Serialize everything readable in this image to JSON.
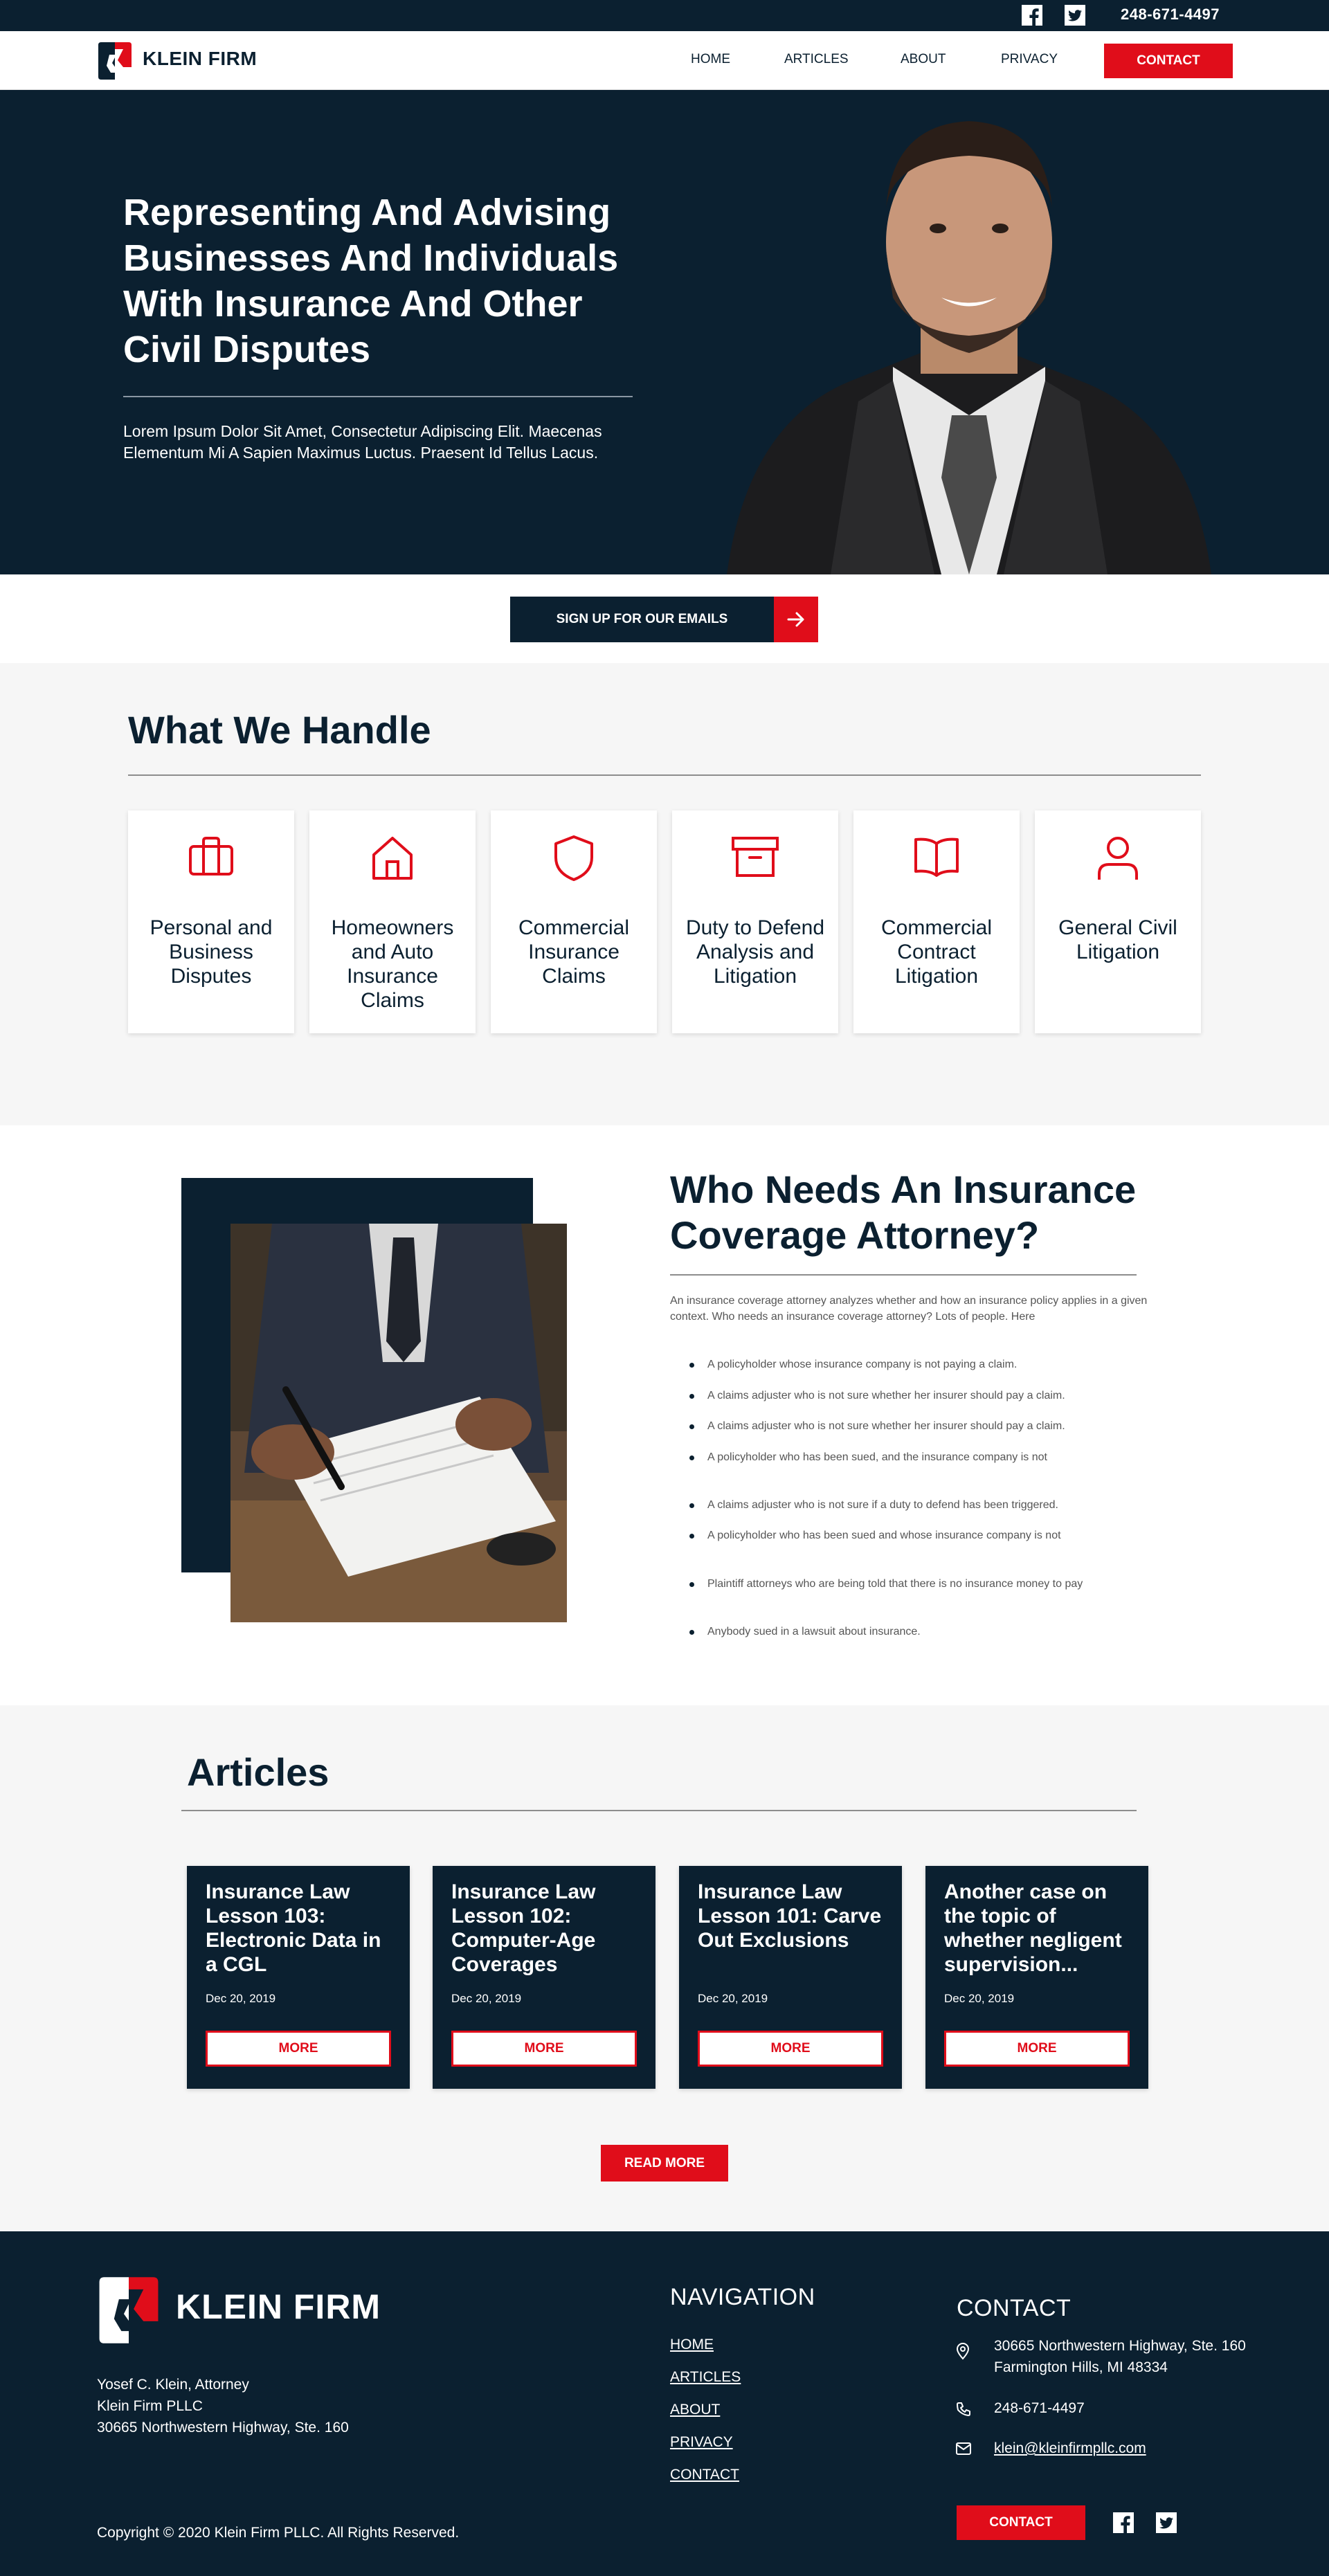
{
  "colors": {
    "navy": "#0b2030",
    "red": "#e00d1a",
    "light": "#f6f6f6"
  },
  "topbar": {
    "phone": "248-671-4497",
    "icons": [
      "facebook-icon",
      "twitter-icon"
    ]
  },
  "header": {
    "logo_text": "KLEIN FIRM",
    "nav": [
      "HOME",
      "ARTICLES",
      "ABOUT",
      "PRIVACY"
    ],
    "contact_label": "CONTACT"
  },
  "hero": {
    "title": "Representing And Advising Businesses And Individuals With Insurance And Other Civil Disputes",
    "subtitle": "Lorem Ipsum Dolor Sit Amet, Consectetur Adipiscing Elit. Maecenas Elementum Mi A Sapien Maximus Luctus. Praesent Id Tellus Lacus."
  },
  "signup": {
    "label": "SIGN UP FOR OUR EMAILS"
  },
  "handle": {
    "title": "What We Handle",
    "cards": [
      {
        "icon": "briefcase-icon",
        "label": "Personal and Business Disputes"
      },
      {
        "icon": "house-icon",
        "label": "Homeowners and Auto Insurance Claims"
      },
      {
        "icon": "shield-icon",
        "label": "Commercial Insurance Claims"
      },
      {
        "icon": "archive-box-icon",
        "label": "Duty to Defend Analysis and Litigation"
      },
      {
        "icon": "open-book-icon",
        "label": "Commercial Contract Litigation"
      },
      {
        "icon": "person-icon",
        "label": "General Civil Litigation"
      }
    ]
  },
  "who": {
    "title": "Who Needs An Insurance Coverage Attorney?",
    "intro": "An insurance coverage attorney analyzes whether and how an insurance policy applies in a given context. Who needs an insurance coverage attorney? Lots of people. Here",
    "items": [
      "A policyholder whose insurance company is not paying a claim.",
      "A claims adjuster who is not sure whether her insurer should pay a claim.",
      "A claims adjuster who is not sure whether her insurer should pay a claim.",
      "A policyholder who has been sued, and the insurance company is not",
      "A claims adjuster who is not sure if a duty to defend has been triggered.",
      "A policyholder who has been sued and whose insurance company is not",
      "Plaintiff attorneys who are being told that there is no insurance money to pay",
      "Anybody sued in a lawsuit about insurance."
    ]
  },
  "articles": {
    "title": "Articles",
    "items": [
      {
        "title": "Insurance Law Lesson 103: Electronic Data in a CGL",
        "date": "Dec 20, 2019",
        "more": "MORE"
      },
      {
        "title": "Insurance Law Lesson 102: Computer-Age Coverages",
        "date": "Dec 20, 2019",
        "more": "MORE"
      },
      {
        "title": "Insurance Law Lesson 101: Carve Out Exclusions",
        "date": "Dec 20, 2019",
        "more": "MORE"
      },
      {
        "title": "Another case on the topic of whether negligent supervision...",
        "date": "Dec 20, 2019",
        "more": "MORE"
      }
    ],
    "read_more": "READ MORE"
  },
  "footer": {
    "logo_text": "KLEIN FIRM",
    "address_lines": [
      "Yosef C. Klein, Attorney",
      "Klein Firm PLLC",
      "30665 Northwestern Highway, Ste. 160"
    ],
    "nav_title": "NAVIGATION",
    "nav": [
      "HOME",
      "ARTICLES",
      "ABOUT",
      "PRIVACY",
      "CONTACT"
    ],
    "contact_title": "CONTACT",
    "contact_address": "30665 Northwestern Highway, Ste. 160 Farmington Hills, MI 48334",
    "contact_phone": "248-671-4497",
    "contact_email": "klein@kleinfirmpllc.com",
    "contact_button": "CONTACT",
    "copyright": "Copyright © 2020 Klein Firm PLLC. All Rights Reserved."
  }
}
